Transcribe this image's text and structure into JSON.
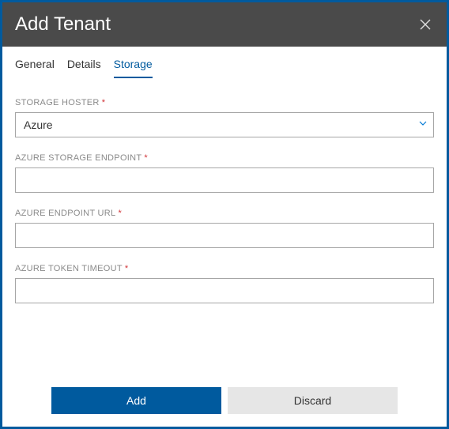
{
  "header": {
    "title": "Add Tenant"
  },
  "tabs": {
    "items": [
      {
        "label": "General",
        "active": false
      },
      {
        "label": "Details",
        "active": false
      },
      {
        "label": "Storage",
        "active": true
      }
    ]
  },
  "form": {
    "storage_hoster": {
      "label": "STORAGE HOSTER",
      "required_mark": "*",
      "value": "Azure"
    },
    "azure_storage_endpoint": {
      "label": "AZURE STORAGE ENDPOINT",
      "required_mark": "*",
      "value": ""
    },
    "azure_endpoint_url": {
      "label": "AZURE ENDPOINT URL",
      "required_mark": "*",
      "value": ""
    },
    "azure_token_timeout": {
      "label": "AZURE TOKEN TIMEOUT",
      "required_mark": "*",
      "value": ""
    }
  },
  "footer": {
    "add_label": "Add",
    "discard_label": "Discard"
  }
}
